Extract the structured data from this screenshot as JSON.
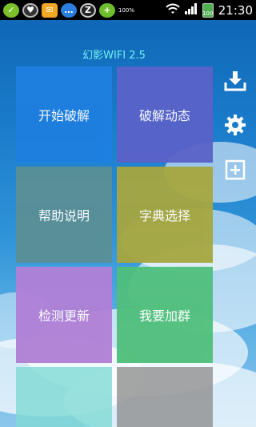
{
  "status_bar": {
    "time": "21:30",
    "battery_percent": "100",
    "small_percent": "100%",
    "notification_icons": [
      "app-icon-green",
      "heart-icon",
      "mail-icon",
      "chat-icon",
      "z-icon",
      "plus-icon"
    ]
  },
  "app": {
    "title": "幻影WIFI 2.5"
  },
  "tiles": [
    {
      "label": "开始破解",
      "color": "#1f7fe0"
    },
    {
      "label": "破解动态",
      "color": "#5a62c8"
    },
    {
      "label": "帮助说明",
      "color": "#5b8f96"
    },
    {
      "label": "字典选择",
      "color": "#a6a63f"
    },
    {
      "label": "检测更新",
      "color": "#b07fd6"
    },
    {
      "label": "我要加群",
      "color": "#4fbf7a"
    },
    {
      "label": "",
      "color": "#7fd9d4"
    },
    {
      "label": "",
      "color": "#8f8f8f"
    }
  ],
  "side_actions": [
    {
      "icon": "download-icon"
    },
    {
      "icon": "gear-icon"
    },
    {
      "icon": "add-icon"
    }
  ]
}
